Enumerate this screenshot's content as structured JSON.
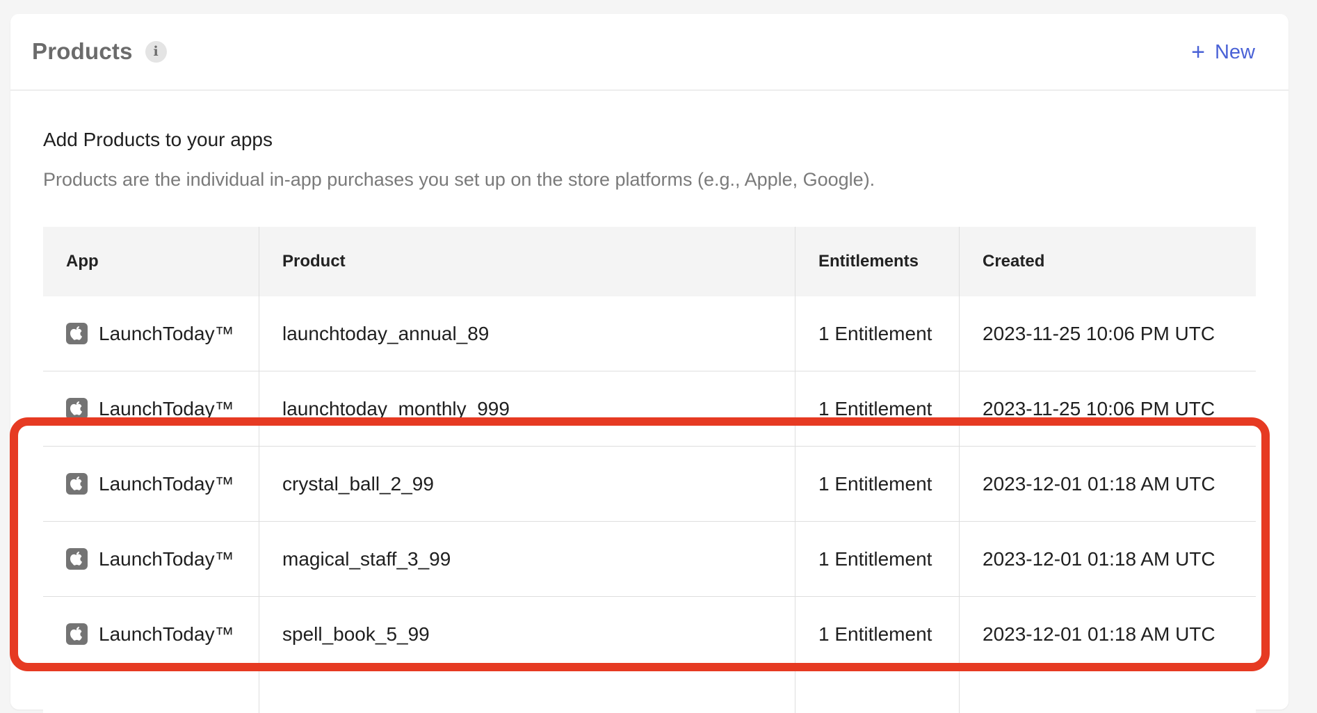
{
  "header": {
    "title": "Products",
    "info_icon": "i",
    "new_icon": "+",
    "new_label": "New"
  },
  "intro": {
    "heading": "Add Products to your apps",
    "description": "Products are the individual in-app purchases you set up on the store platforms (e.g., Apple, Google)."
  },
  "table": {
    "columns": [
      "App",
      "Product",
      "Entitlements",
      "Created"
    ],
    "rows": [
      {
        "app": "LaunchToday™",
        "product": "launchtoday_annual_89",
        "entitlements": "1 Entitlement",
        "created": "2023-11-25 10:06 PM UTC"
      },
      {
        "app": "LaunchToday™",
        "product": "launchtoday_monthly_999",
        "entitlements": "1 Entitlement",
        "created": "2023-11-25 10:06 PM UTC"
      },
      {
        "app": "LaunchToday™",
        "product": "crystal_ball_2_99",
        "entitlements": "1 Entitlement",
        "created": "2023-12-01 01:18 AM UTC"
      },
      {
        "app": "LaunchToday™",
        "product": "magical_staff_3_99",
        "entitlements": "1 Entitlement",
        "created": "2023-12-01 01:18 AM UTC"
      },
      {
        "app": "LaunchToday™",
        "product": "spell_book_5_99",
        "entitlements": "1 Entitlement",
        "created": "2023-12-01 01:18 AM UTC"
      }
    ]
  },
  "colors": {
    "accent": "#4a62d6",
    "highlight": "#e63a22",
    "app_icon_bg": "#747474"
  },
  "icons": {
    "app_platform": "apple-icon"
  }
}
